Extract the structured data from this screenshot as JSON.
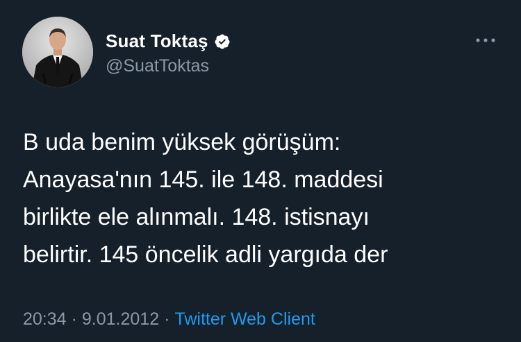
{
  "author": {
    "display_name": "Suat Toktaş",
    "handle": "@SuatToktas",
    "verified": true
  },
  "tweet": {
    "lines": [
      "B uda benim yüksek görüşüm:",
      "Anayasa'nın 145. ile 148. maddesi",
      "birlikte ele alınmalı. 148. istisnayı",
      "belirtir. 145 öncelik adli yargıda der"
    ]
  },
  "meta": {
    "time": "20:34",
    "separator": "·",
    "date": "9.01.2012",
    "source": "Twitter Web Client"
  },
  "icons": {
    "verified": "verified-badge-icon",
    "more": "more-options-icon"
  },
  "colors": {
    "background": "#15202b",
    "primary_text": "#ffffff",
    "secondary_text": "#8b98a5",
    "link": "#1d9bf0"
  }
}
